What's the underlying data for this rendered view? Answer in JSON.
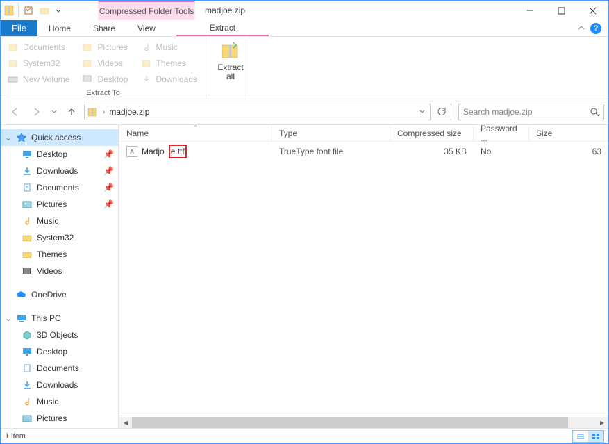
{
  "title": "madjoe.zip",
  "context_tab": {
    "label": "Compressed Folder Tools",
    "sub": "Extract"
  },
  "tabs": {
    "file": "File",
    "home": "Home",
    "share": "Share",
    "view": "View",
    "extract": "Extract"
  },
  "ribbon": {
    "group1_title": "Extract To",
    "btns": [
      "Documents",
      "Pictures",
      "Music",
      "System32",
      "Videos",
      "Themes",
      "New Volume",
      "Desktop",
      "Downloads"
    ],
    "extract_all": "Extract\nall"
  },
  "address": {
    "current": "madjoe.zip",
    "search_placeholder": "Search madjoe.zip"
  },
  "columns": {
    "name": "Name",
    "type": "Type",
    "csize": "Compressed size",
    "pw": "Password ...",
    "size": "Size"
  },
  "row": {
    "name_prefix": "Madjo",
    "name_mid": "e.ttf",
    "type": "TrueType font file",
    "csize": "35 KB",
    "pw": "No",
    "size": "63"
  },
  "sidebar": {
    "quick_access": "Quick access",
    "pinned": [
      "Desktop",
      "Downloads",
      "Documents",
      "Pictures"
    ],
    "freq": [
      "Music",
      "System32",
      "Themes",
      "Videos"
    ],
    "onedrive": "OneDrive",
    "this_pc": "This PC",
    "pc_children": [
      "3D Objects",
      "Desktop",
      "Documents",
      "Downloads",
      "Music",
      "Pictures"
    ]
  },
  "status": {
    "items": "1 item"
  }
}
